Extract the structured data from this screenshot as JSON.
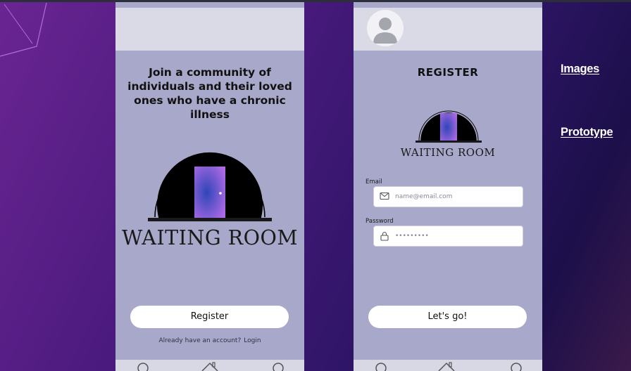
{
  "colors": {
    "phone_bg": "#a8a8ca",
    "header_bg": "#dadae6",
    "door_gradient_start": "#2e46b8",
    "door_gradient_end": "#b06ae6",
    "button_bg": "#ffffff"
  },
  "onboarding": {
    "tagline": "Join a community of individuals and their loved ones who have a chronic illness",
    "brand": "WAITING ROOM",
    "register_label": "Register",
    "login_prompt": "Already have an account?",
    "login_link": "Login"
  },
  "register": {
    "title": "REGISTER",
    "brand": "WAITING ROOM",
    "email_label": "Email",
    "email_placeholder": "name@email.com",
    "email_icon": "envelope-icon",
    "password_label": "Password",
    "password_value": "•••••••••",
    "password_icon": "lock-icon",
    "submit_label": "Let's go!"
  },
  "navbar": {
    "icons": [
      "search-icon",
      "home-icon",
      "profile-icon"
    ]
  },
  "side_links": {
    "images": "Images",
    "prototype": "Prototype"
  }
}
